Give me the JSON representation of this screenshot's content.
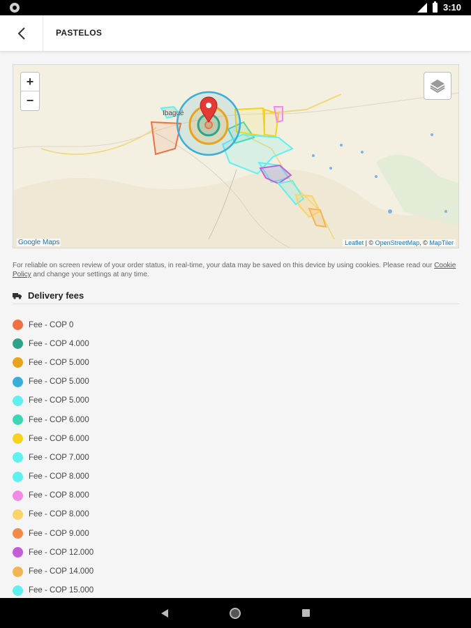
{
  "status_bar": {
    "time": "3:10"
  },
  "app_bar": {
    "title": "PASTELOS"
  },
  "map": {
    "zoom_in_label": "+",
    "zoom_out_label": "−",
    "brand_label": "Google Maps",
    "attribution_leaflet": "Leaflet",
    "attribution_sep1": " | © ",
    "attribution_osm": "OpenStreetMap",
    "attribution_sep2": ", © ",
    "attribution_maptiler": "MapTiler",
    "place_label": "Ibagué"
  },
  "cookie_notice": {
    "text_before": "For reliable on screen review of your order status, in real-time, your data may be saved on this device by using cookies. Please read our ",
    "link": "Cookie Policy",
    "text_after": " and change your settings at any time."
  },
  "delivery_fees": {
    "title": "Delivery fees",
    "items": [
      {
        "label": "Fee - COP 0",
        "color": "#f0703f"
      },
      {
        "label": "Fee - COP 4.000",
        "color": "#2ea38a"
      },
      {
        "label": "Fee - COP 5.000",
        "color": "#e8a31d"
      },
      {
        "label": "Fee - COP 5.000",
        "color": "#3aaed8"
      },
      {
        "label": "Fee - COP 5.000",
        "color": "#5ff0f0"
      },
      {
        "label": "Fee - COP 6.000",
        "color": "#3fd6b6"
      },
      {
        "label": "Fee - COP 6.000",
        "color": "#f6d21c"
      },
      {
        "label": "Fee - COP 7.000",
        "color": "#5ff0f0"
      },
      {
        "label": "Fee - COP 8.000",
        "color": "#5ff0f0"
      },
      {
        "label": "Fee - COP 8.000",
        "color": "#f28ae8"
      },
      {
        "label": "Fee - COP 8.000",
        "color": "#f8d46a"
      },
      {
        "label": "Fee - COP 9.000",
        "color": "#f38a45"
      },
      {
        "label": "Fee - COP 12.000",
        "color": "#c45ed8"
      },
      {
        "label": "Fee - COP 14.000",
        "color": "#f5b454"
      },
      {
        "label": "Fee - COP 15.000",
        "color": "#5ff0f0"
      }
    ]
  }
}
